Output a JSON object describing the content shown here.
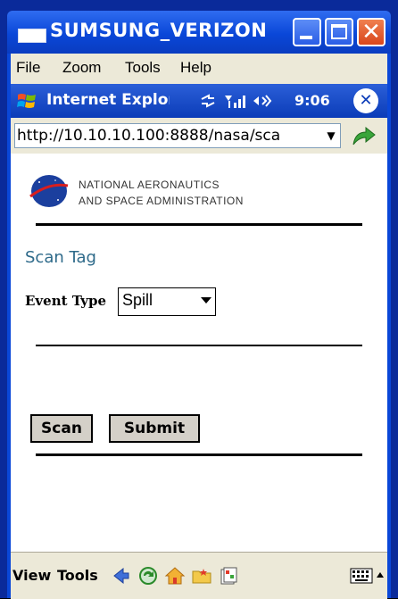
{
  "window": {
    "title": "SUMSUNG_VERIZON"
  },
  "menu": {
    "items": [
      "File",
      "Zoom",
      "Tools",
      "Help"
    ]
  },
  "browser": {
    "title": "Internet Explorer",
    "time": "9:06",
    "status_icons": "⇄ ▼ ◀‹"
  },
  "address": {
    "url": "http://10.10.10.100:8888/nasa/sca"
  },
  "page": {
    "org_line1": "NATIONAL AERONAUTICS",
    "org_line2": "AND SPACE ADMINISTRATION",
    "heading": "Scan Tag",
    "event_type_label": "Event Type",
    "event_type_value": "Spill",
    "scan_button": "Scan",
    "submit_button": "Submit"
  },
  "toolbar": {
    "view_label": "View",
    "tools_label": "Tools"
  },
  "colors": {
    "titlebar": "#0a47d8",
    "heading": "#2e6a8a",
    "frame": "#0a2a9a"
  }
}
